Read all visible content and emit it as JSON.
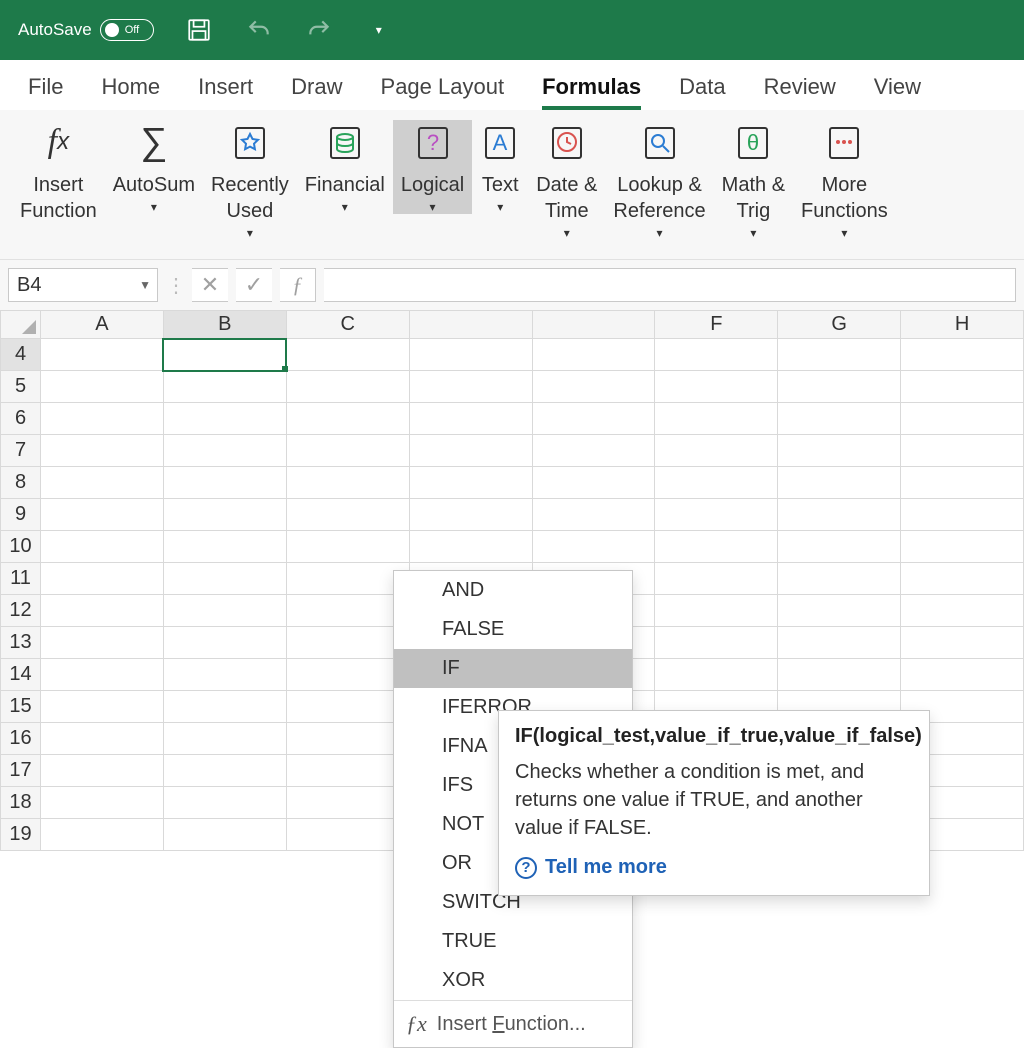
{
  "titlebar": {
    "autosave_label": "AutoSave",
    "autosave_state": "Off"
  },
  "tabs": [
    "File",
    "Home",
    "Insert",
    "Draw",
    "Page Layout",
    "Formulas",
    "Data",
    "Review",
    "View"
  ],
  "active_tab": "Formulas",
  "ribbon": {
    "insert_function": "Insert\nFunction",
    "autosum": "AutoSum",
    "recently_used": "Recently\nUsed",
    "financial": "Financial",
    "logical": "Logical",
    "text": "Text",
    "datetime": "Date &\nTime",
    "lookup": "Lookup &\nReference",
    "math": "Math &\nTrig",
    "more": "More\nFunctions"
  },
  "namebox": "B4",
  "columns": [
    "A",
    "B",
    "C",
    "",
    "",
    "F",
    "G",
    "H"
  ],
  "rows": [
    "4",
    "5",
    "6",
    "7",
    "8",
    "9",
    "10",
    "11",
    "12",
    "13",
    "14",
    "15",
    "16",
    "17",
    "18",
    "19"
  ],
  "selected_col_index": 1,
  "selected_row_index": 0,
  "logical_menu": {
    "items": [
      "AND",
      "FALSE",
      "IF",
      "IFERROR",
      "IFNA",
      "IFS",
      "NOT",
      "OR",
      "SWITCH",
      "TRUE",
      "XOR"
    ],
    "hover_index": 2,
    "footer": "Insert Function...",
    "footer_underline_char": "F"
  },
  "tooltip": {
    "title": "IF(logical_test,value_if_true,value_if_false)",
    "body": "Checks whether a condition is met, and returns one value if TRUE, and another value if FALSE.",
    "link": "Tell me more"
  }
}
